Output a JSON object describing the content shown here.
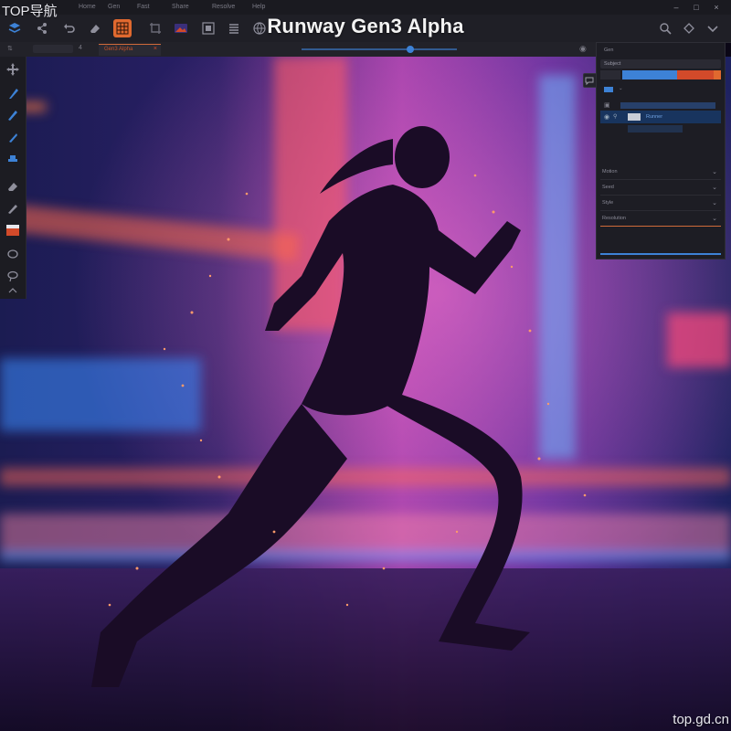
{
  "watermark": {
    "top_left": "TOP导航",
    "bottom_right": "top.gd.cn"
  },
  "title": "Runway Gen3 Alpha",
  "menubar": {
    "items": [
      "Home",
      "Gen",
      "Fast",
      "Share",
      "Resolve",
      "Help"
    ]
  },
  "document": {
    "tab_label": "Gen3 Alpha"
  },
  "panel": {
    "header": "Gen",
    "layers_title": "Subject",
    "layer_name": "Runner",
    "sections": [
      "Motion",
      "Seed",
      "Style",
      "Resolution"
    ]
  },
  "colors": {
    "accent": "#3d82d6",
    "accent_red": "#d24a2a",
    "accent_orange": "#e0692f"
  }
}
